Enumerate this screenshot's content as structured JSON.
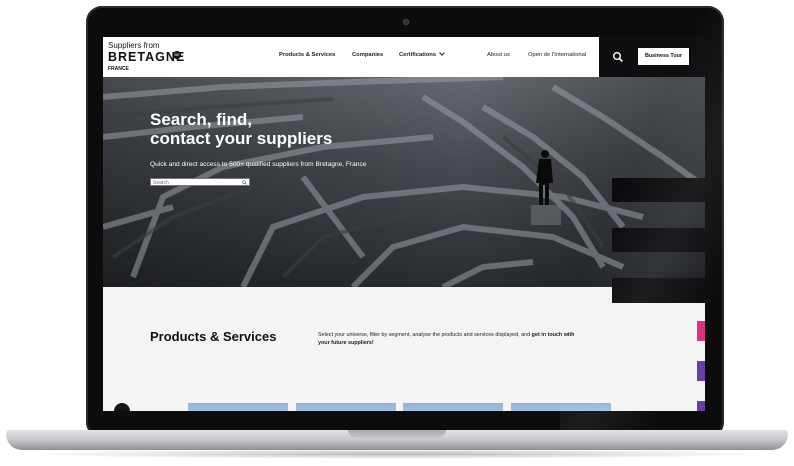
{
  "header": {
    "logo": {
      "line1": "Suppliers from",
      "line2": "BRETAGNE",
      "badge": "BE",
      "line3": "FRANCE"
    },
    "nav": [
      {
        "label": "Products & Services"
      },
      {
        "label": "Companies"
      },
      {
        "label": "Certifications"
      },
      {
        "label": "About us"
      },
      {
        "label": "Open de l'International"
      }
    ],
    "cta_label": "Business Tour",
    "icons": {
      "search": "search-icon",
      "certifications_caret": "chevron-down-icon"
    }
  },
  "hero": {
    "title": "Search, find,\ncontact your suppliers",
    "subtitle": "Quick and direct access to 500+ qualified suppliers from Bretagne, France",
    "search_placeholder": "Search"
  },
  "products": {
    "title": "Products & Services",
    "desc_plain": "Select your universe, filter by segment, analyse the products and services displayed, and",
    "desc_bold": "get in touch with your future suppliers!"
  },
  "colors": {
    "dark": "#0e0e10",
    "accent_pink": "#d6337f",
    "accent_purple": "#6b3fa0",
    "thumb_blue": "#9ab9dc"
  }
}
